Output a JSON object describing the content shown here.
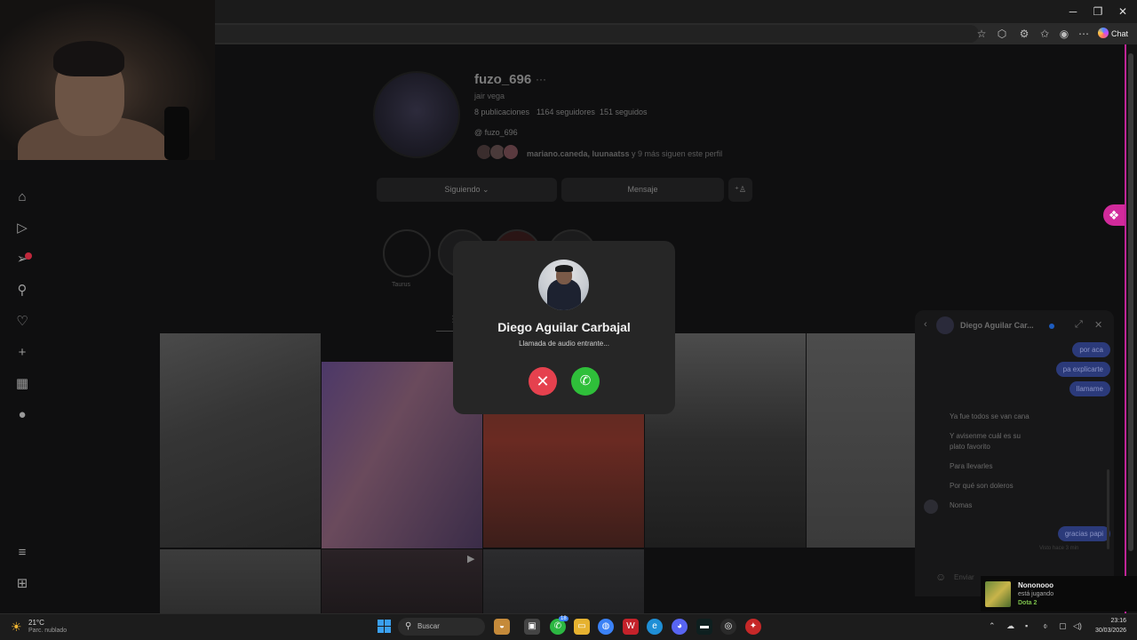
{
  "browser": {
    "chat_label": "Chat"
  },
  "sidebar": {
    "notification_count": "5"
  },
  "profile": {
    "username": "fuzo_696",
    "full_name": "jair vega",
    "posts": "8 publicaciones",
    "followers": "1164 seguidores",
    "following": "151 seguidos",
    "threads": "fuzo_696",
    "followed_by_names": "mariano.caneda, luunaatss",
    "followed_by_rest": " y 9 más siguen este perfil",
    "following_button": "Siguiendo",
    "message_button": "Mensaje",
    "highlight_label": "Taurus"
  },
  "call": {
    "caller_name": "Diego Aguilar Carbajal",
    "status": "Llamada de audio entrante..."
  },
  "chat": {
    "contact_name": "Diego Aguilar Car...",
    "outgoing_top": [
      "por aca",
      "pa explicarte",
      "llamame"
    ],
    "incoming": [
      "Ya fue todos se van cana",
      "Y avisenme cuál es su",
      "plato favorito",
      "Para llevarles",
      "Por qué son doleros",
      "Nomas"
    ],
    "outgoing_last": "gracias papi",
    "seen": "Visto hace 3 min",
    "input_placeholder": "Enviar"
  },
  "toast": {
    "name": "Nononooo",
    "status": "está jugando",
    "game": "Dota 2"
  },
  "taskbar": {
    "temperature": "21°C",
    "weather": "Parc. nublado",
    "search_placeholder": "Buscar",
    "whatsapp_badge": "18",
    "time": "23:16",
    "date": "30/03/2026"
  },
  "colors": {
    "accent_pink": "#c02597",
    "decline_red": "#e5414e",
    "accept_green": "#2fbf3a",
    "out_bubble": "#2b3a7a"
  }
}
